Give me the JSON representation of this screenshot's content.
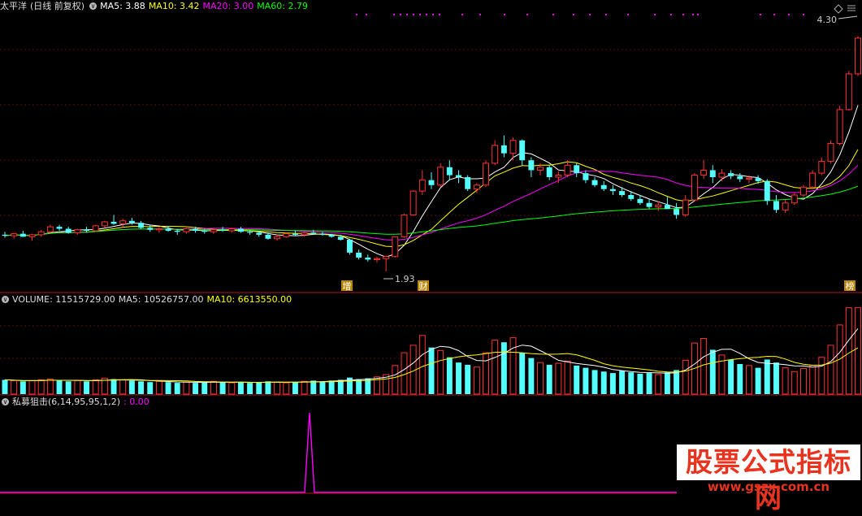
{
  "main_header": {
    "stock": "太平洋",
    "mode": "(日线 前复权)",
    "ma5": "MA5: 3.88",
    "ma10": "MA10: 3.42",
    "ma20": "MA20: 3.00",
    "ma60": "MA60: 2.79"
  },
  "vol_header": {
    "volume": "VOLUME: 11515729.00",
    "ma5": "MA5: 10526757.00",
    "ma10": "MA10: 6613550.00"
  },
  "ind_header": {
    "name": "私募狙击",
    "params": "(6,14,95,95,1,2)",
    "value": ": 0.00"
  },
  "markers": {
    "high": "4.30",
    "low": "1.93",
    "event_1": "增",
    "event_2": "财",
    "event_3": "榜"
  },
  "watermark": {
    "title": "股票公式指标网",
    "url": "www.gszx.com.cn"
  },
  "colors": {
    "up": "#ff3232",
    "down": "#54ffff",
    "ma5": "#ffffff",
    "ma10": "#ffff00",
    "ma20": "#ff00ff",
    "ma60": "#00ff00",
    "divider": "#b4141e"
  },
  "chart_data": [
    {
      "type": "candlestick",
      "title": "太平洋 (日线 前复权)",
      "ylim": [
        1.8,
        4.5
      ],
      "ohlc": [
        [
          2.3,
          2.33,
          2.27,
          2.29
        ],
        [
          2.29,
          2.32,
          2.26,
          2.31
        ],
        [
          2.31,
          2.34,
          2.28,
          2.28
        ],
        [
          2.28,
          2.31,
          2.24,
          2.3
        ],
        [
          2.3,
          2.35,
          2.28,
          2.33
        ],
        [
          2.33,
          2.4,
          2.31,
          2.38
        ],
        [
          2.38,
          2.4,
          2.34,
          2.36
        ],
        [
          2.36,
          2.38,
          2.31,
          2.32
        ],
        [
          2.32,
          2.36,
          2.3,
          2.35
        ],
        [
          2.35,
          2.38,
          2.32,
          2.34
        ],
        [
          2.34,
          2.4,
          2.33,
          2.39
        ],
        [
          2.39,
          2.44,
          2.37,
          2.43
        ],
        [
          2.43,
          2.5,
          2.4,
          2.41
        ],
        [
          2.41,
          2.46,
          2.38,
          2.44
        ],
        [
          2.44,
          2.47,
          2.4,
          2.42
        ],
        [
          2.42,
          2.44,
          2.36,
          2.37
        ],
        [
          2.37,
          2.4,
          2.33,
          2.35
        ],
        [
          2.35,
          2.38,
          2.32,
          2.36
        ],
        [
          2.36,
          2.39,
          2.33,
          2.34
        ],
        [
          2.34,
          2.36,
          2.3,
          2.33
        ],
        [
          2.33,
          2.37,
          2.31,
          2.36
        ],
        [
          2.36,
          2.38,
          2.32,
          2.34
        ],
        [
          2.34,
          2.36,
          2.31,
          2.33
        ],
        [
          2.33,
          2.36,
          2.31,
          2.35
        ],
        [
          2.35,
          2.38,
          2.33,
          2.34
        ],
        [
          2.34,
          2.37,
          2.32,
          2.36
        ],
        [
          2.36,
          2.38,
          2.32,
          2.33
        ],
        [
          2.33,
          2.35,
          2.3,
          2.32
        ],
        [
          2.32,
          2.34,
          2.28,
          2.3
        ],
        [
          2.3,
          2.32,
          2.25,
          2.26
        ],
        [
          2.26,
          2.3,
          2.24,
          2.28
        ],
        [
          2.28,
          2.32,
          2.27,
          2.31
        ],
        [
          2.31,
          2.34,
          2.29,
          2.3
        ],
        [
          2.3,
          2.33,
          2.28,
          2.32
        ],
        [
          2.32,
          2.35,
          2.3,
          2.31
        ],
        [
          2.31,
          2.33,
          2.29,
          2.3
        ],
        [
          2.3,
          2.31,
          2.27,
          2.28
        ],
        [
          2.28,
          2.3,
          2.24,
          2.25
        ],
        [
          2.25,
          2.26,
          2.1,
          2.12
        ],
        [
          2.12,
          2.15,
          2.05,
          2.07
        ],
        [
          2.07,
          2.1,
          2.03,
          2.05
        ],
        [
          2.05,
          2.08,
          2.02,
          2.06
        ],
        [
          2.06,
          2.09,
          1.93,
          2.08
        ],
        [
          2.08,
          2.28,
          2.07,
          2.28
        ],
        [
          2.28,
          2.51,
          2.27,
          2.5
        ],
        [
          2.5,
          2.75,
          2.49,
          2.74
        ],
        [
          2.74,
          2.95,
          2.7,
          2.85
        ],
        [
          2.85,
          2.93,
          2.76,
          2.8
        ],
        [
          2.8,
          3.02,
          2.78,
          2.98
        ],
        [
          2.98,
          3.05,
          2.85,
          2.9
        ],
        [
          2.9,
          2.95,
          2.82,
          2.88
        ],
        [
          2.88,
          2.9,
          2.74,
          2.76
        ],
        [
          2.76,
          2.82,
          2.72,
          2.8
        ],
        [
          2.8,
          3.05,
          2.78,
          3.02
        ],
        [
          3.02,
          3.25,
          3.0,
          3.2
        ],
        [
          3.2,
          3.3,
          3.08,
          3.12
        ],
        [
          3.12,
          3.28,
          3.05,
          3.25
        ],
        [
          3.25,
          3.26,
          3.0,
          3.05
        ],
        [
          3.05,
          3.08,
          2.88,
          2.95
        ],
        [
          2.95,
          3.02,
          2.9,
          2.98
        ],
        [
          2.98,
          3.0,
          2.85,
          2.88
        ],
        [
          2.88,
          2.94,
          2.82,
          2.9
        ],
        [
          2.9,
          3.05,
          2.88,
          3.0
        ],
        [
          3.0,
          3.02,
          2.88,
          2.92
        ],
        [
          2.92,
          2.95,
          2.82,
          2.85
        ],
        [
          2.85,
          2.88,
          2.78,
          2.8
        ],
        [
          2.8,
          2.84,
          2.74,
          2.76
        ],
        [
          2.76,
          2.8,
          2.7,
          2.74
        ],
        [
          2.74,
          2.78,
          2.68,
          2.7
        ],
        [
          2.7,
          2.74,
          2.64,
          2.66
        ],
        [
          2.66,
          2.7,
          2.6,
          2.62
        ],
        [
          2.62,
          2.66,
          2.56,
          2.58
        ],
        [
          2.58,
          2.64,
          2.54,
          2.6
        ],
        [
          2.6,
          2.68,
          2.56,
          2.56
        ],
        [
          2.56,
          2.62,
          2.46,
          2.5
        ],
        [
          2.5,
          2.7,
          2.48,
          2.65
        ],
        [
          2.65,
          2.92,
          2.64,
          2.9
        ],
        [
          2.9,
          3.05,
          2.86,
          2.95
        ],
        [
          2.95,
          3.0,
          2.82,
          2.88
        ],
        [
          2.88,
          2.96,
          2.84,
          2.92
        ],
        [
          2.92,
          2.95,
          2.86,
          2.89
        ],
        [
          2.89,
          2.92,
          2.83,
          2.86
        ],
        [
          2.86,
          2.9,
          2.82,
          2.87
        ],
        [
          2.87,
          2.9,
          2.81,
          2.84
        ],
        [
          2.84,
          2.86,
          2.6,
          2.64
        ],
        [
          2.64,
          2.7,
          2.52,
          2.55
        ],
        [
          2.55,
          2.65,
          2.52,
          2.62
        ],
        [
          2.62,
          2.72,
          2.6,
          2.7
        ],
        [
          2.7,
          2.8,
          2.68,
          2.78
        ],
        [
          2.78,
          2.95,
          2.76,
          2.92
        ],
        [
          2.92,
          3.08,
          2.9,
          3.04
        ],
        [
          3.04,
          3.25,
          3.02,
          3.22
        ],
        [
          3.22,
          3.6,
          3.2,
          3.56
        ],
        [
          3.56,
          3.95,
          3.55,
          3.92
        ],
        [
          3.92,
          4.3,
          3.9,
          4.28
        ]
      ],
      "moving_averages": [
        "MA5",
        "MA10",
        "MA20",
        "MA60"
      ]
    },
    {
      "type": "bar",
      "title": "VOLUME",
      "values": [
        1.9,
        1.8,
        1.7,
        1.8,
        1.9,
        2.0,
        1.8,
        1.7,
        1.8,
        1.7,
        1.9,
        2.1,
        2.0,
        1.9,
        1.8,
        1.7,
        1.6,
        1.7,
        1.6,
        1.5,
        1.6,
        1.5,
        1.6,
        1.7,
        1.6,
        1.5,
        1.6,
        1.5,
        1.6,
        1.7,
        1.6,
        1.5,
        1.6,
        1.7,
        1.8,
        1.7,
        1.8,
        1.9,
        2.2,
        2.0,
        2.1,
        2.3,
        2.6,
        3.8,
        5.5,
        6.5,
        7.8,
        6.2,
        5.8,
        4.9,
        4.2,
        3.9,
        3.6,
        5.5,
        7.2,
        6.9,
        7.5,
        5.5,
        4.8,
        4.2,
        3.9,
        4.1,
        4.4,
        3.8,
        3.5,
        3.2,
        3.0,
        2.8,
        3.1,
        2.9,
        2.7,
        2.8,
        2.6,
        2.9,
        3.2,
        4.5,
        6.8,
        7.4,
        5.9,
        5.2,
        4.6,
        4.0,
        3.8,
        3.5,
        4.6,
        4.2,
        3.5,
        3.0,
        3.4,
        3.8,
        4.9,
        6.5,
        9.2,
        11.5,
        11.5
      ],
      "unit": "million shares (approx.)"
    },
    {
      "type": "line",
      "title": "私募狙击",
      "note_series": "spike to 1 at bar 39, 0 elsewhere",
      "ylim": [
        0,
        1
      ]
    }
  ]
}
